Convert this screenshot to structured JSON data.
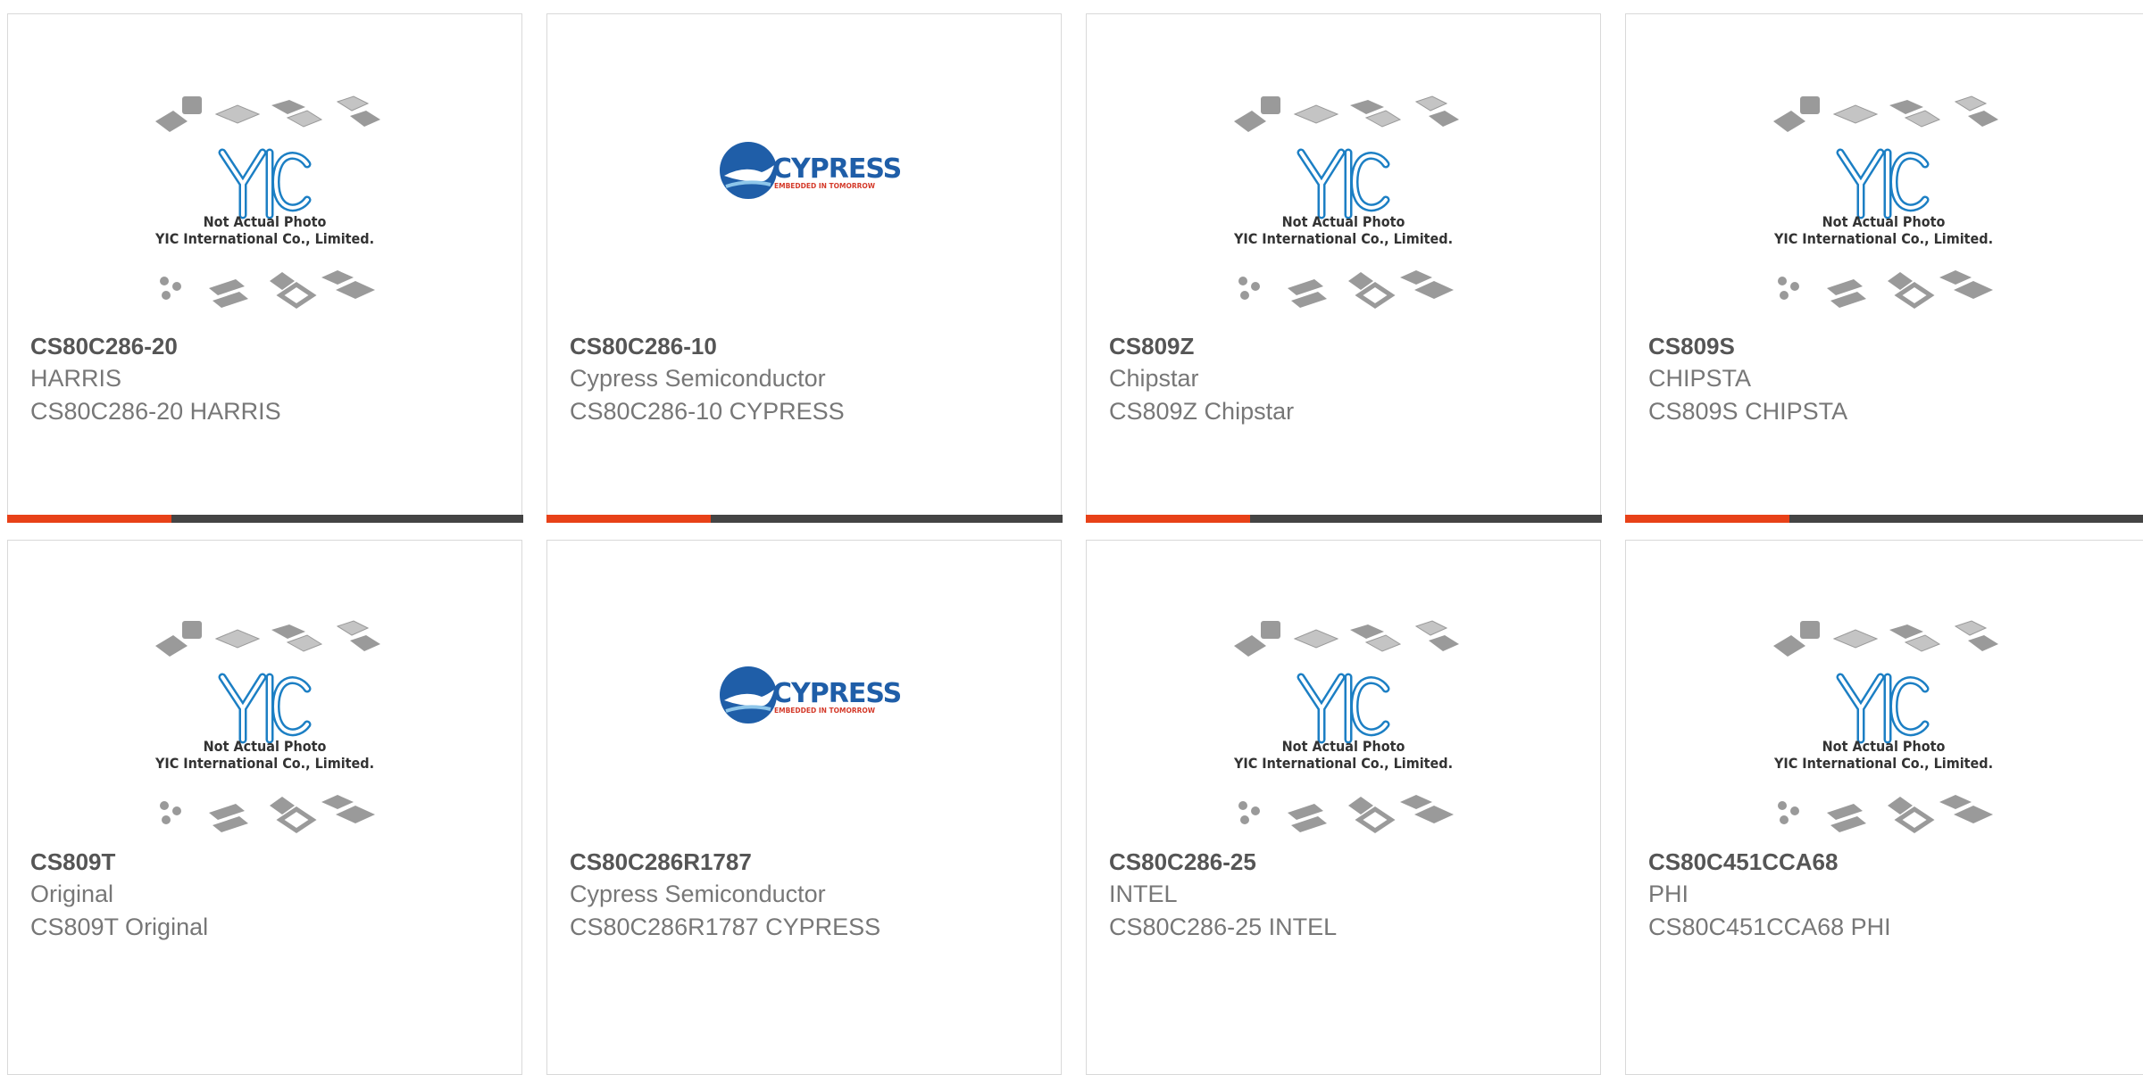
{
  "products": [
    {
      "part": "CS80C286-20",
      "manufacturer": "HARRIS",
      "description": "CS80C286-20 HARRIS",
      "image": "yic-placeholder"
    },
    {
      "part": "CS80C286-10",
      "manufacturer": "Cypress Semiconductor",
      "description": "CS80C286-10 CYPRESS",
      "image": "cypress-logo"
    },
    {
      "part": "CS809Z",
      "manufacturer": "Chipstar",
      "description": "CS809Z Chipstar",
      "image": "yic-placeholder"
    },
    {
      "part": "CS809S",
      "manufacturer": "CHIPSTA",
      "description": "CS809S CHIPSTA",
      "image": "yic-placeholder"
    },
    {
      "part": "CS809T",
      "manufacturer": "Original",
      "description": "CS809T Original",
      "image": "yic-placeholder"
    },
    {
      "part": "CS80C286R1787",
      "manufacturer": "Cypress Semiconductor",
      "description": "CS80C286R1787 CYPRESS",
      "image": "cypress-logo"
    },
    {
      "part": "CS80C286-25",
      "manufacturer": "INTEL",
      "description": "CS80C286-25 INTEL",
      "image": "yic-placeholder"
    },
    {
      "part": "CS80C451CCA68",
      "manufacturer": "PHI",
      "description": "CS80C451CCA68 PHI",
      "image": "yic-placeholder"
    }
  ],
  "placeholder": {
    "brand": "YIC",
    "line1": "Not Actual Photo",
    "line2": "YIC International Co., Limited."
  },
  "cypress": {
    "wordmark": "CYPRESS",
    "tagline": "EMBEDDED IN TOMORROW"
  },
  "colors": {
    "accent": "#e84118",
    "bar": "#444444",
    "yic_blue": "#1c7fc4",
    "cypress_blue": "#1f5ea8"
  }
}
